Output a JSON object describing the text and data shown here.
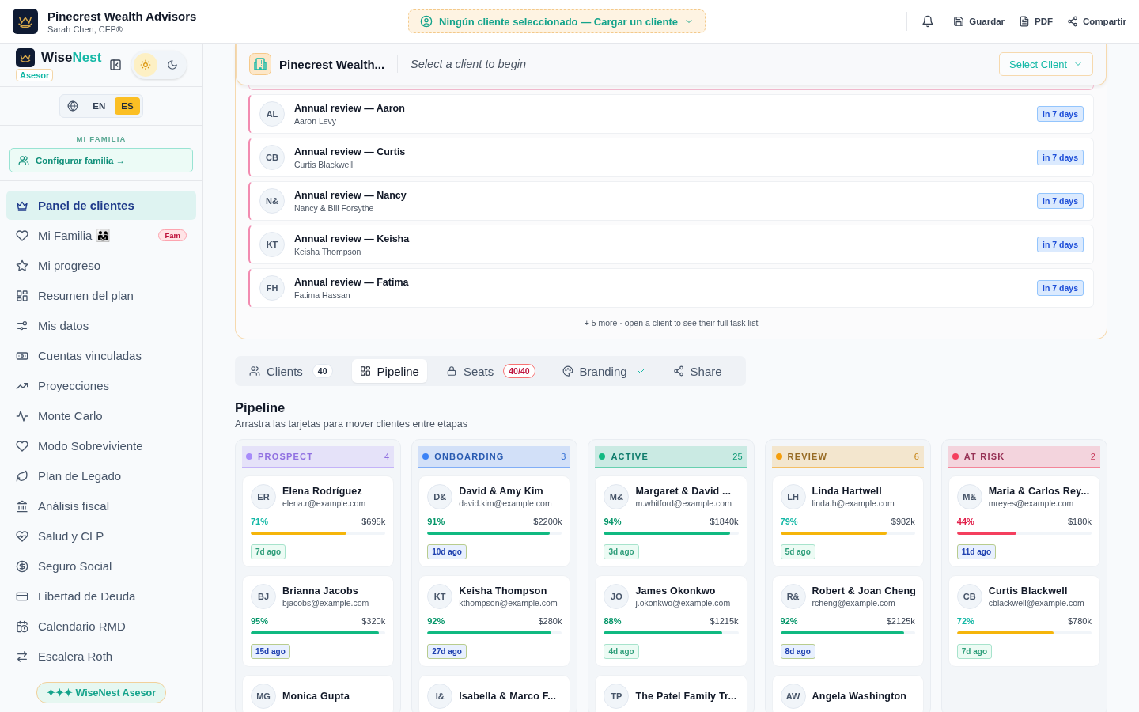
{
  "header": {
    "firm": "Pinecrest Wealth Advisors",
    "advisor": "Sarah Chen, CFP®",
    "client_picker": "Ningún cliente seleccionado — Cargar un cliente",
    "actions": [
      {
        "label": "Guardar"
      },
      {
        "label": "PDF"
      },
      {
        "label": "Compartir"
      }
    ]
  },
  "sidebar": {
    "brand_a": "Wise",
    "brand_b": "Nest",
    "role": "Asesor",
    "themes": [
      {
        "selected": true
      },
      {
        "selected": false
      }
    ],
    "languages": [
      {
        "label": "EN",
        "selected": false
      },
      {
        "label": "ES",
        "selected": true
      }
    ],
    "section": "MI FAMILIA",
    "setup_button": "Configurar familia →",
    "items": [
      {
        "label": "Panel de clientes",
        "selected": true
      },
      {
        "label": "Mi Familia 👨‍👩‍👧",
        "selected": false,
        "badge": "Fam"
      },
      {
        "label": "Mi progreso",
        "selected": false
      },
      {
        "label": "Resumen del plan",
        "selected": false
      },
      {
        "label": "Mis datos",
        "selected": false
      },
      {
        "label": "Cuentas vinculadas",
        "selected": false
      },
      {
        "label": "Proyecciones",
        "selected": false
      },
      {
        "label": "Monte Carlo",
        "selected": false
      },
      {
        "label": "Modo Sobreviviente",
        "selected": false
      },
      {
        "label": "Plan de Legado",
        "selected": false
      },
      {
        "label": "Análisis fiscal",
        "selected": false
      },
      {
        "label": "Salud y CLP",
        "selected": false
      },
      {
        "label": "Seguro Social",
        "selected": false
      },
      {
        "label": "Libertad de Deuda",
        "selected": false
      },
      {
        "label": "Calendario RMD",
        "selected": false
      },
      {
        "label": "Escalera Roth",
        "selected": false
      }
    ],
    "footer_badge": "✦✦✦ WiseNest Asesor"
  },
  "client_panel": {
    "title": "Pinecrest Wealth...",
    "prompt": "Select a client to begin",
    "select_button": "Select Client",
    "tasks": [
      {
        "initials": "AL",
        "title": "Annual review — Aaron",
        "client": "Aaron Levy",
        "due": "in 7 days"
      },
      {
        "initials": "CB",
        "title": "Annual review — Curtis",
        "client": "Curtis Blackwell",
        "due": "in 7 days"
      },
      {
        "initials": "N&",
        "title": "Annual review — Nancy",
        "client": "Nancy & Bill Forsythe",
        "due": "in 7 days"
      },
      {
        "initials": "KT",
        "title": "Annual review — Keisha",
        "client": "Keisha Thompson",
        "due": "in 7 days"
      },
      {
        "initials": "FH",
        "title": "Annual review — Fatima",
        "client": "Fatima Hassan",
        "due": "in 7 days"
      }
    ],
    "more": "+ 5 more · open a client to see their full task list"
  },
  "tabs": [
    {
      "label": "Clients",
      "count": "40",
      "selected": false,
      "kind": "count"
    },
    {
      "label": "Pipeline",
      "selected": true,
      "kind": "plain"
    },
    {
      "label": "Seats",
      "count": "40/40",
      "selected": false,
      "kind": "alert"
    },
    {
      "label": "Branding",
      "selected": false,
      "kind": "done"
    },
    {
      "label": "Share",
      "selected": false,
      "kind": "plain"
    }
  ],
  "pipeline": {
    "title": "Pipeline",
    "subtitle": "Arrastra las tarjetas para mover clientes entre etapas",
    "stages": [
      {
        "label": "PROSPECT",
        "count": "4",
        "color": "#a78bfa",
        "faded": true,
        "cards": [
          {
            "initials": "ER",
            "name": "Elena Rodríguez",
            "email": "elena.r@example.com",
            "percent": "71%",
            "level": 0.71,
            "value": "$695k",
            "contact": {
              "text": "7d ago",
              "kind": "recent"
            }
          },
          {
            "initials": "BJ",
            "name": "Brianna Jacobs",
            "email": "bjacobs@example.com",
            "percent": "95%",
            "level": 0.95,
            "value": "$320k",
            "contact": {
              "text": "15d ago",
              "kind": "stale"
            }
          },
          {
            "initials": "MG",
            "name": "Monica Gupta"
          }
        ]
      },
      {
        "label": "ONBOARDING",
        "count": "3",
        "color": "#3b82f6",
        "faded": false,
        "cards": [
          {
            "initials": "D&",
            "name": "David & Amy Kim",
            "email": "david.kim@example.com",
            "percent": "91%",
            "level": 0.91,
            "value": "$2200k",
            "contact": {
              "text": "10d ago",
              "kind": "stale"
            }
          },
          {
            "initials": "KT",
            "name": "Keisha Thompson",
            "email": "kthompson@example.com",
            "percent": "92%",
            "level": 0.92,
            "value": "$280k",
            "contact": {
              "text": "27d ago",
              "kind": "stale"
            }
          },
          {
            "initials": "I&",
            "name": "Isabella & Marco F..."
          }
        ]
      },
      {
        "label": "ACTIVE",
        "count": "25",
        "color": "#10b981",
        "faded": false,
        "cards": [
          {
            "initials": "M&",
            "name": "Margaret & David ...",
            "email": "m.whitford@example.com",
            "percent": "94%",
            "level": 0.94,
            "value": "$1840k",
            "contact": {
              "text": "3d ago",
              "kind": "recent"
            }
          },
          {
            "initials": "JO",
            "name": "James Okonkwo",
            "email": "j.okonkwo@example.com",
            "percent": "88%",
            "level": 0.88,
            "value": "$1215k",
            "contact": {
              "text": "4d ago",
              "kind": "recent"
            }
          },
          {
            "initials": "TP",
            "name": "The Patel Family Tr..."
          }
        ]
      },
      {
        "label": "REVIEW",
        "count": "6",
        "color": "#f59e0b",
        "faded": false,
        "cards": [
          {
            "initials": "LH",
            "name": "Linda Hartwell",
            "email": "linda.h@example.com",
            "percent": "79%",
            "level": 0.79,
            "value": "$982k",
            "contact": {
              "text": "5d ago",
              "kind": "recent"
            }
          },
          {
            "initials": "R&",
            "name": "Robert & Joan Cheng",
            "email": "rcheng@example.com",
            "percent": "92%",
            "level": 0.92,
            "value": "$2125k",
            "contact": {
              "text": "8d ago",
              "kind": "stale"
            }
          },
          {
            "initials": "AW",
            "name": "Angela Washington"
          }
        ]
      },
      {
        "label": "AT RISK",
        "count": "2",
        "color": "#f43f5e",
        "faded": false,
        "cards": [
          {
            "initials": "M&",
            "name": "Maria & Carlos Rey...",
            "email": "mreyes@example.com",
            "percent": "44%",
            "level": 0.44,
            "value": "$180k",
            "contact": {
              "text": "11d ago",
              "kind": "stale"
            }
          },
          {
            "initials": "CB",
            "name": "Curtis Blackwell",
            "email": "cblackwell@example.com",
            "percent": "72%",
            "level": 0.72,
            "value": "$780k",
            "contact": {
              "text": "7d ago",
              "kind": "recent"
            }
          }
        ]
      }
    ]
  }
}
